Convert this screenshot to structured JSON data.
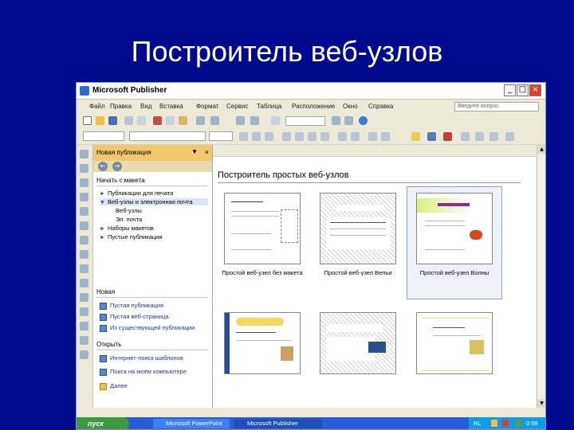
{
  "slide": {
    "title": "Построитель веб-узлов"
  },
  "window": {
    "title": "Microsoft Publisher",
    "min": "_",
    "max": "□",
    "close": "×"
  },
  "menu": {
    "items": [
      "Файл",
      "Правка",
      "Вид",
      "Вставка",
      "Формат",
      "Сервис",
      "Таблица",
      "Расположение",
      "Окно",
      "Справка"
    ],
    "help_placeholder": "Введите вопрос"
  },
  "task_pane": {
    "title": "Новая публикация",
    "section_start": "Начать с макета",
    "tree": [
      {
        "label": "Публикации для печати"
      },
      {
        "label": "Веб-узлы и электронная почта"
      },
      {
        "label": "Веб-узлы"
      },
      {
        "label": "Эл. почта"
      },
      {
        "label": "Наборы макетов"
      },
      {
        "label": "Пустые публикации"
      }
    ],
    "section_new": "Новая",
    "new_links": [
      "Пустая публикация",
      "Пустая веб-страница",
      "Из существующей публикации"
    ],
    "section_open": "Открыть",
    "open_links": [
      "Интернет-поиск шаблонов",
      "Поиск на моём компьютере",
      "Далее"
    ]
  },
  "gallery": {
    "title": "Построитель простых веб-узлов",
    "captions": [
      "Простой веб-узел без макета",
      "Простой веб-узел Вельи",
      "Простой веб-узел Волны"
    ]
  },
  "taskbar": {
    "start": "пуск",
    "tasks": [
      "Microsoft PowerPoint",
      "Microsoft Publisher"
    ],
    "lang": "RL",
    "clock": "0:58"
  }
}
